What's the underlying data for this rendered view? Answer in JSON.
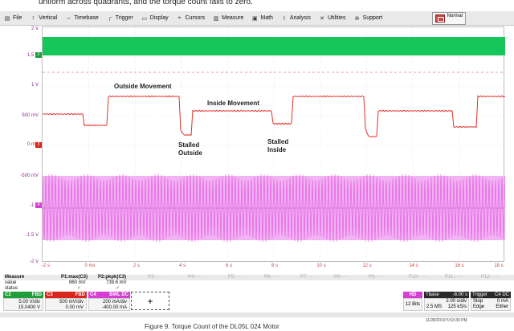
{
  "caption_top": "uniform across quadrants, and the torque count falls to zero.",
  "caption_bottom": "Figure 9. Torque Count of the DL05L 024 Motor",
  "menu": [
    {
      "label": "File",
      "icon": "file-icon"
    },
    {
      "label": "Vertical",
      "icon": "vertical-icon"
    },
    {
      "label": "Timebase",
      "icon": "timebase-icon"
    },
    {
      "label": "Trigger",
      "icon": "trigger-icon"
    },
    {
      "label": "Display",
      "icon": "display-icon"
    },
    {
      "label": "Cursors",
      "icon": "cursors-icon"
    },
    {
      "label": "Measure",
      "icon": "measure-icon"
    },
    {
      "label": "Math",
      "icon": "math-icon"
    },
    {
      "label": "Analysis",
      "icon": "analysis-icon"
    },
    {
      "label": "Utilities",
      "icon": "utilities-icon"
    },
    {
      "label": "Support",
      "icon": "support-icon"
    }
  ],
  "normal_button": "Normal",
  "y_labels": [
    "2 V",
    "1.5 V",
    "1 V",
    "500 mV",
    "0 mV",
    "-500 mV",
    "-1 V",
    "-1.5 V",
    "-2 V"
  ],
  "x_labels": [
    "-2 s",
    "0 ms",
    "2 s",
    "4 s",
    "6 s",
    "8 s",
    "10 s",
    "12 s",
    "14 s",
    "16 s",
    "18 s"
  ],
  "annotations": {
    "outside_movement": "Outside Movement",
    "inside_movement": "Inside Movement",
    "stalled_outside_1": "Stalled",
    "stalled_outside_2": "Outside",
    "stalled_inside_1": "Stalled",
    "stalled_inside_2": "Inside"
  },
  "measure": {
    "row_labels": [
      "Measure",
      "value",
      "status"
    ],
    "columns": [
      {
        "name": "P1:max(C3)",
        "value": "860 mV",
        "status": "✓"
      },
      {
        "name": "P2:pkpk(C3)",
        "value": "739.6 mV",
        "status": "✓"
      },
      {
        "name": "P3:- - -",
        "value": "",
        "status": ""
      },
      {
        "name": "P4:- - -",
        "value": "",
        "status": ""
      },
      {
        "name": "P5:- - -",
        "value": "",
        "status": ""
      },
      {
        "name": "P6:- - -",
        "value": "",
        "status": ""
      },
      {
        "name": "P7:- - -",
        "value": "",
        "status": ""
      },
      {
        "name": "P8:- - -",
        "value": "",
        "status": ""
      },
      {
        "name": "P9:- - -",
        "value": "",
        "status": ""
      },
      {
        "name": "P10:- - -",
        "value": "",
        "status": ""
      },
      {
        "name": "P11:- - -",
        "value": "",
        "status": ""
      },
      {
        "name": "P12:- - -",
        "value": "",
        "status": ""
      }
    ]
  },
  "channels": [
    {
      "name": "C2",
      "tags": "FBD",
      "line1": "5.00 V/div",
      "line2": "15.0400 V",
      "color": "#1f9e3a"
    },
    {
      "name": "C3",
      "tags": "FBD",
      "line1": "500 mV/div",
      "line2": "0.00 mV",
      "color": "#d9261c"
    },
    {
      "name": "C4",
      "tags": "BWL DC",
      "line1": "200 mA/div",
      "line2": "-400.00 mA",
      "color": "#d63fd6"
    }
  ],
  "plus_label": "+",
  "hd": {
    "badge": "HD",
    "bits": "12 Bits",
    "color": "#d63fd6"
  },
  "tbase": {
    "label": "Tbase",
    "value": "-8.00 s",
    "line1": "2.00 s/div",
    "line2a": "2.5 MS",
    "line2b": "125 kS/s"
  },
  "trigger": {
    "label": "Trigger",
    "tag": "C4 DC",
    "line1a": "Stop",
    "line1b": "0 mA",
    "line2a": "Edge",
    "line2b": "Either"
  },
  "timestamp": "11/28/2019 5:53:30 PM",
  "colors": {
    "green_trace": "#17c65a",
    "red_trace": "#e5322b",
    "magenta_trace": "#e35ee3",
    "grid": "#d9d9d9"
  }
}
